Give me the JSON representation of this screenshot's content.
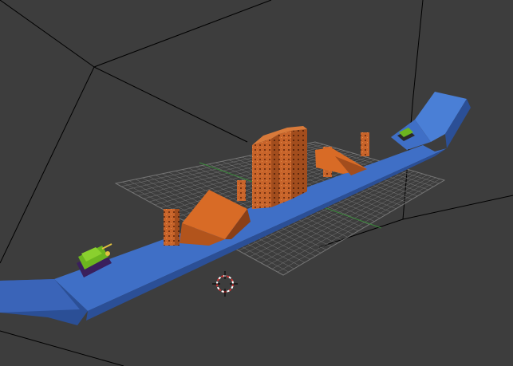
{
  "viewport": {
    "editor": "3d-view",
    "shading": "solid",
    "colors": {
      "background": "#3d3d3d",
      "room_wire": "#000000",
      "grid": "#8a8a8a",
      "track_top": "#3f6fc6",
      "track_side": "#2b4f96",
      "crate": "#c8642a",
      "crate_dark": "#8a3f17",
      "ramp": "#d86b26",
      "vehicle_body": "#6cb51f",
      "vehicle_tracks": "#3a1f5c",
      "axis_x": "#b03a3a",
      "axis_y": "#3aa03a"
    },
    "objects": [
      "room-wireframe",
      "floor-grid",
      "track",
      "crate-stacks",
      "ramp",
      "player-tank",
      "enemy-tank",
      "3d-cursor"
    ]
  }
}
